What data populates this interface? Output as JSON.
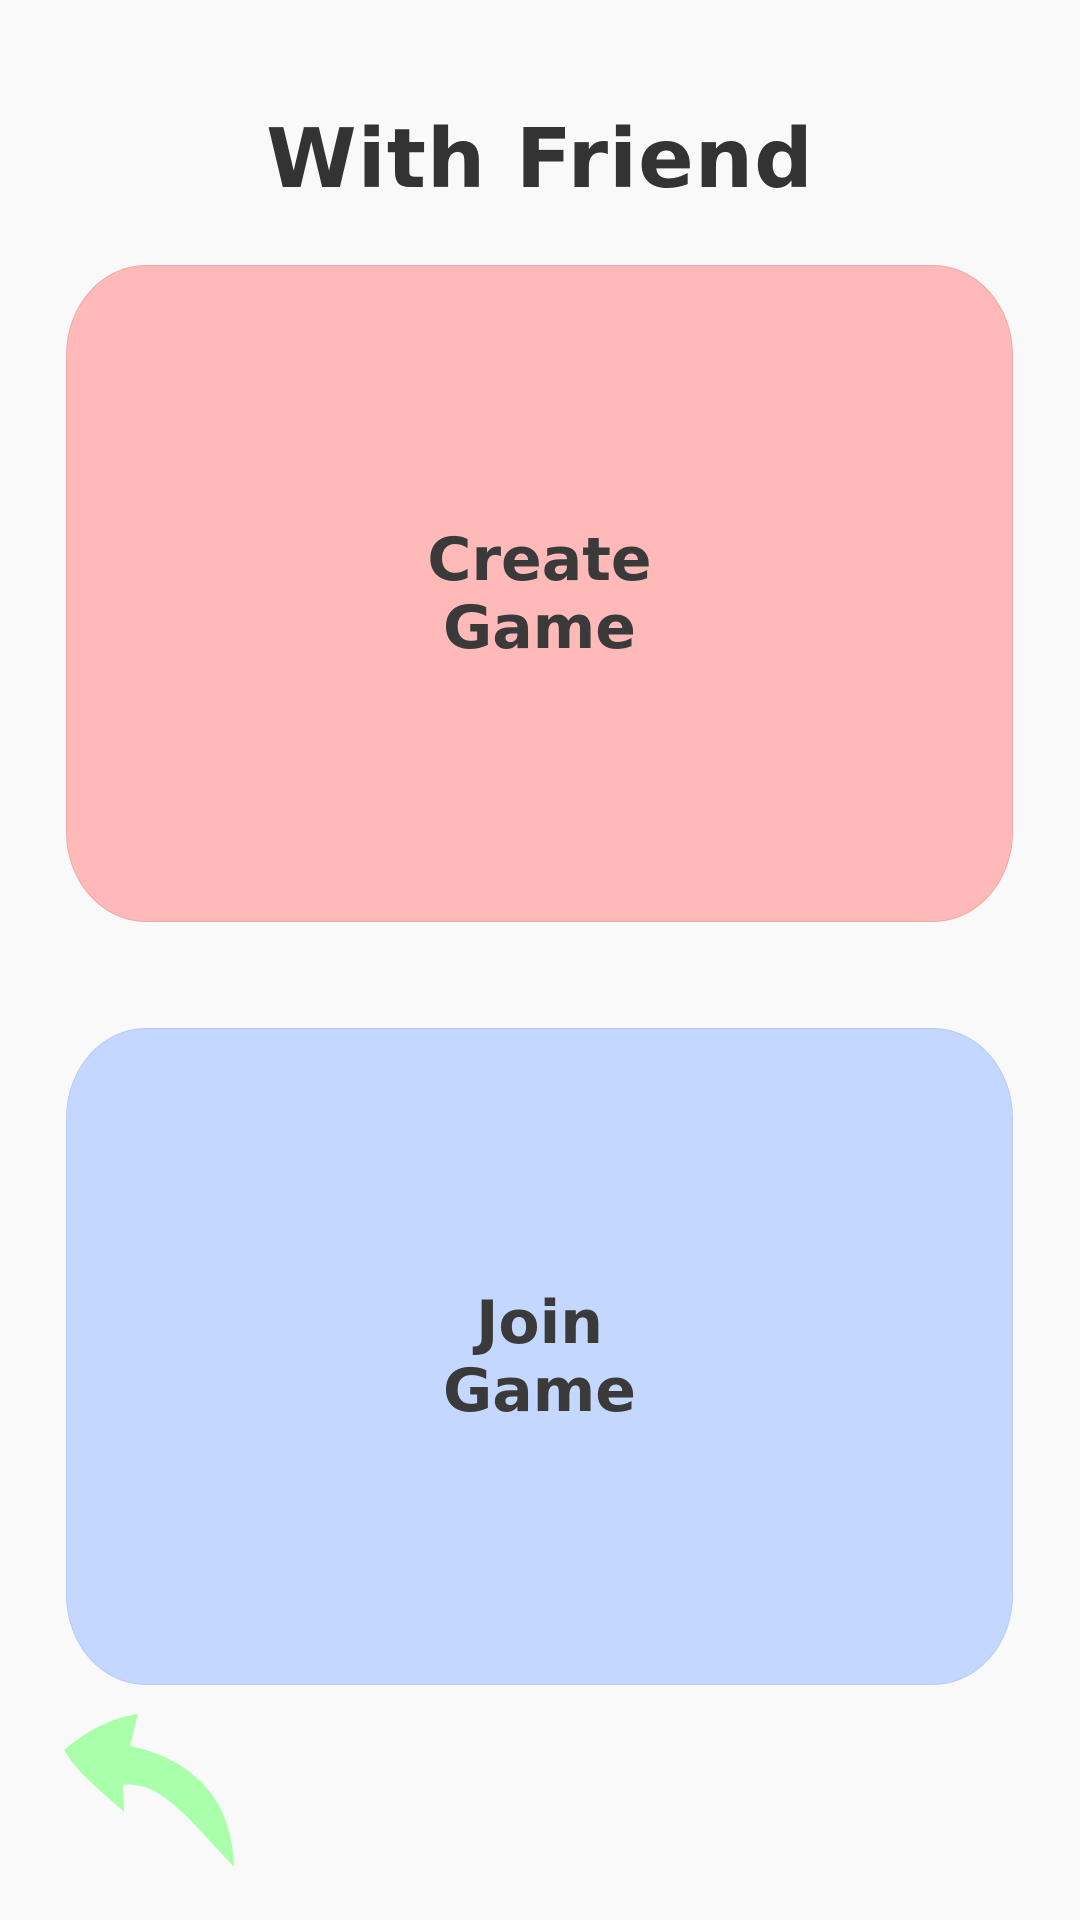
{
  "header": {
    "title": "With Friend"
  },
  "cards": {
    "create_label": "Create Game",
    "join_label": "Join Game"
  },
  "icons": {
    "back": "back-arrow-icon"
  },
  "colors": {
    "background": "#f9f9f9",
    "create_card": "#ffb9b9",
    "join_card": "#c4d7ff",
    "back_arrow": "#aaffaa",
    "text": "#3a3a3a"
  }
}
